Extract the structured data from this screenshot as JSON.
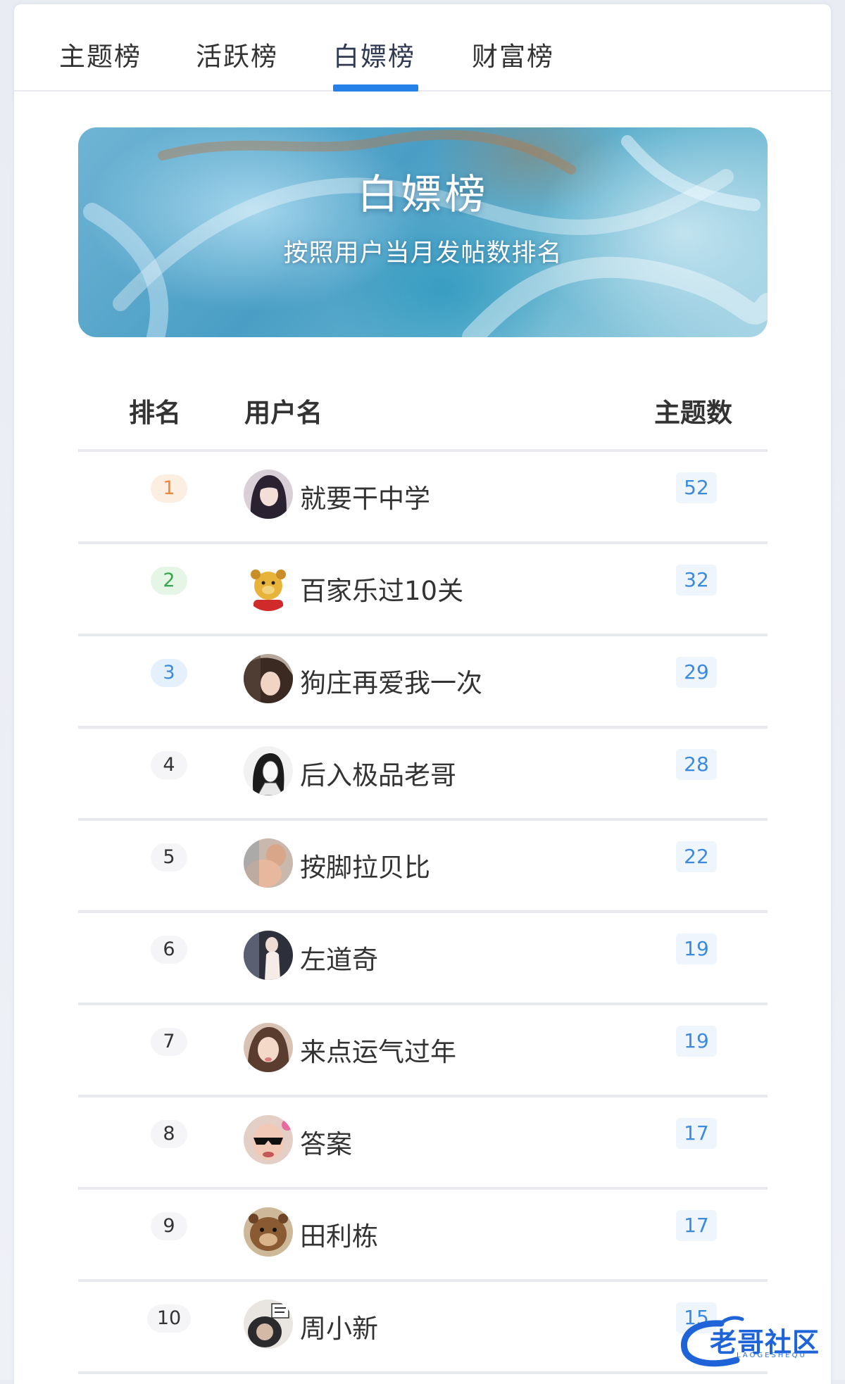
{
  "tabs": [
    {
      "label": "主题榜",
      "active": false
    },
    {
      "label": "活跃榜",
      "active": false
    },
    {
      "label": "白嫖榜",
      "active": true
    },
    {
      "label": "财富榜",
      "active": false
    }
  ],
  "colors": {
    "accent": "#2581e8",
    "rank_1": "#f0873a",
    "rank_2": "#36a84a",
    "rank_3": "#3a8be0",
    "count_text": "#3a8be0"
  },
  "banner": {
    "title": "白嫖榜",
    "subtitle": "按照用户当月发帖数排名"
  },
  "table": {
    "headers": {
      "rank": "排名",
      "username": "用户名",
      "count": "主题数"
    },
    "rows": [
      {
        "rank": "1",
        "username": "就要干中学",
        "count": "52"
      },
      {
        "rank": "2",
        "username": "百家乐过10关",
        "count": "32"
      },
      {
        "rank": "3",
        "username": "狗庄再爱我一次",
        "count": "29"
      },
      {
        "rank": "4",
        "username": "后入极品老哥",
        "count": "28"
      },
      {
        "rank": "5",
        "username": "按脚拉贝比",
        "count": "22"
      },
      {
        "rank": "6",
        "username": "左道奇",
        "count": "19"
      },
      {
        "rank": "7",
        "username": "来点运气过年",
        "count": "19"
      },
      {
        "rank": "8",
        "username": "答案",
        "count": "17"
      },
      {
        "rank": "9",
        "username": "田利栋",
        "count": "17"
      },
      {
        "rank": "10",
        "username": "周小新",
        "count": "15"
      }
    ]
  },
  "watermark": {
    "text": "老哥社区",
    "sub": "LAOGESHEQU"
  }
}
